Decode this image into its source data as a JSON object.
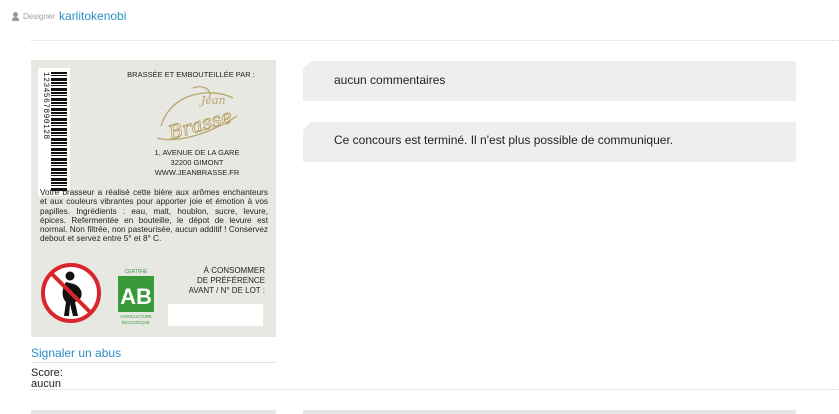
{
  "designer": {
    "label": "Designer",
    "name": "karlitokenobi"
  },
  "beer_label": {
    "barcode_digits": "1234567890128",
    "brewed_by": "BRASSÉE ET EMBOUTEILLÉE PAR :",
    "logo_text": "Jean Brasse",
    "address": [
      "1, AVENUE DE LA GARE",
      "32200 GIMONT",
      "WWW.JEANBRASSE.FR"
    ],
    "description": "Votre brasseur a réalisé cette bière aux arômes enchanteurs et aux couleurs vibrantes pour apporter joie et émotion à vos papilles. Ingrédients : eau, malt, houblon, sucre, levure, épices. Refermentée en bouteille, le dépot de levure est normal. Non filtrée, non pasteurisée, aucun additif ! Conservez debout et servez entre 5° et 8° C.",
    "ab_logo": {
      "top": "CERTIFIÉ",
      "letters": "AB",
      "bottom1": "AGRICULTURE",
      "bottom2": "BIOLOGIQUE"
    },
    "consume": [
      "À CONSOMMER",
      "DE PRÉFÉRENCE",
      "AVANT / N° DE LOT :"
    ]
  },
  "report_link": "Signaler un abus",
  "score": {
    "label": "Score:",
    "value": "aucun"
  },
  "comments": {
    "none": "aucun commentaires",
    "closed": "Ce concours est terminé. Il n'est plus possible de communiquer."
  },
  "colors": {
    "link": "#2a8fc5",
    "bubble": "#eeeeee",
    "label_bg": "#e8e8e3"
  },
  "icons": {
    "user": "user-icon",
    "pregnancy": "no-pregnant-women-icon",
    "organic": "ab-organic-logo"
  }
}
